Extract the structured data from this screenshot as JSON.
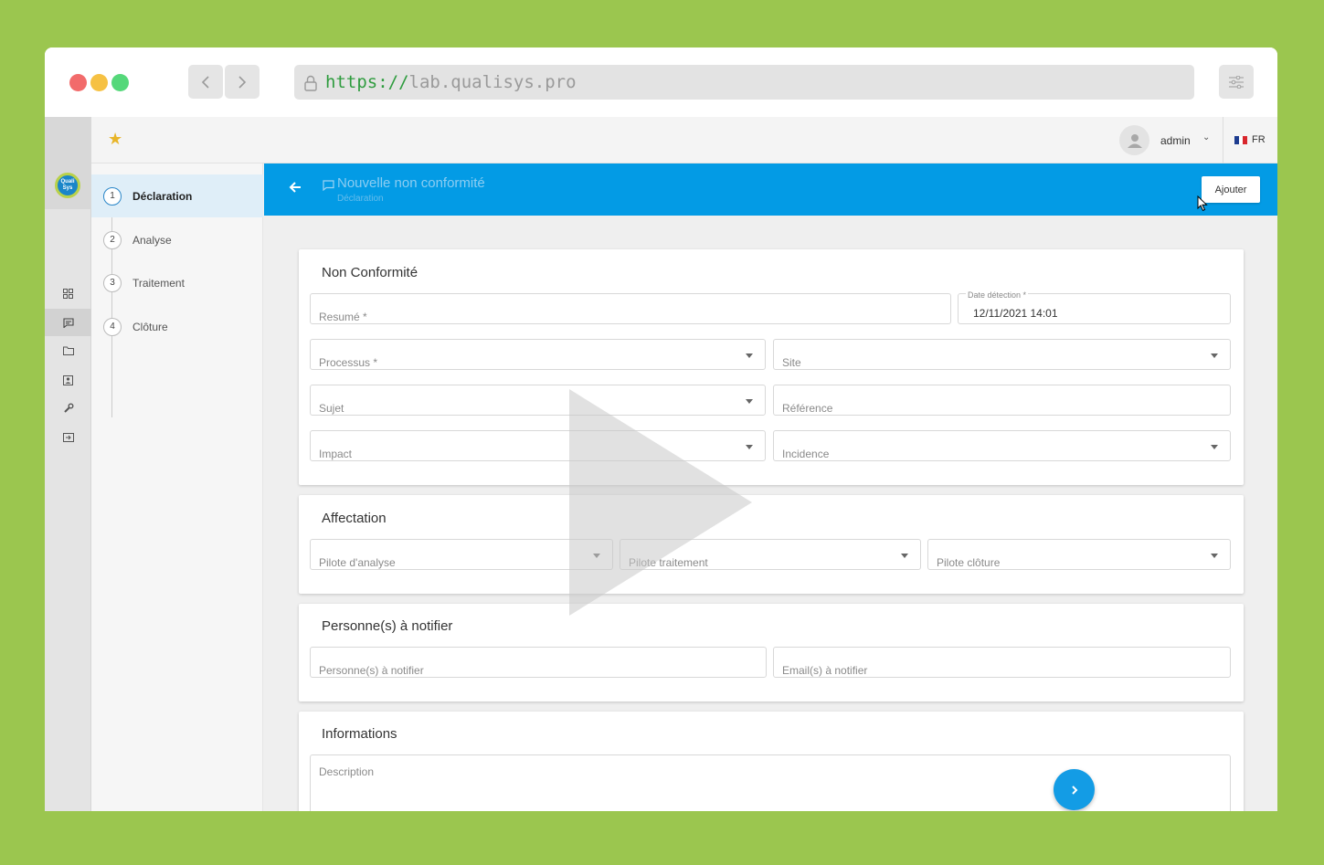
{
  "browser": {
    "url_protocol": "https://",
    "url_host": "lab.qualisys.pro"
  },
  "sidebar_logo_text": "Quali Sys",
  "topbar": {
    "user_name": "admin",
    "language": "FR"
  },
  "steps": [
    {
      "num": "1",
      "label": "Déclaration"
    },
    {
      "num": "2",
      "label": "Analyse"
    },
    {
      "num": "3",
      "label": "Traitement"
    },
    {
      "num": "4",
      "label": "Clôture"
    }
  ],
  "header": {
    "title": "Nouvelle non conformité",
    "subtitle": "Déclaration",
    "add_label": "Ajouter"
  },
  "sections": {
    "non_conformite": {
      "title": "Non Conformité",
      "resume": "Resumé *",
      "date_label": "Date détection *",
      "date_value": "12/11/2021 14:01",
      "processus": "Processus *",
      "site": "Site",
      "sujet": "Sujet",
      "reference": "Référence",
      "impact": "Impact",
      "incidence": "Incidence"
    },
    "affectation": {
      "title": "Affectation",
      "pilote_analyse": "Pilote d'analyse",
      "pilote_traitement": "Pilote traitement",
      "pilote_cloture": "Pilote clôture"
    },
    "notifier": {
      "title": "Personne(s) à notifier",
      "personnes": "Personne(s) à notifier",
      "emails": "Email(s) à notifier"
    },
    "informations": {
      "title": "Informations",
      "description": "Description"
    }
  },
  "colors": {
    "background": "#9bc64f",
    "primary": "#039be5",
    "fab": "#139ce5",
    "star": "#e8b529"
  },
  "icons": {
    "favorite": "star-icon",
    "back": "arrow-left-icon",
    "next": "chevron-right-icon"
  }
}
